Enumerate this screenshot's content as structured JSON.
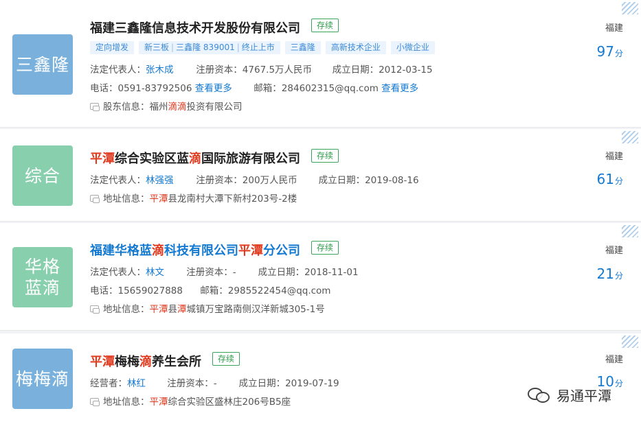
{
  "colors": {
    "logo_blue": "#7ab1dc",
    "logo_green": "#88cfae",
    "highlight_red": "#e0391e",
    "link_blue": "#1479d0",
    "status_green": "#2f9a4c"
  },
  "companies": [
    {
      "logo_lines": [
        "三鑫隆"
      ],
      "name_parts": [
        {
          "t": "福建三鑫隆信息技术开发股份有限公司",
          "hl": false
        }
      ],
      "status": "存续",
      "tags": [
        "定向增发",
        "新三板",
        "三鑫隆",
        "839001",
        "终止上市",
        "三鑫隆",
        "高新技术企业",
        "小微企业"
      ],
      "legal_rep_label": "法定代表人：",
      "legal_rep": "张木成",
      "capital_label": "注册资本：",
      "capital": "4767.5万人民币",
      "founded_label": "成立日期：",
      "founded": "2012-03-15",
      "phone_label": "电话：",
      "phone": "0591-83792506",
      "more_label": "查看更多",
      "email_label": "邮箱：",
      "email": "284602315@qq.com",
      "info_label": "股东信息：",
      "info_parts": [
        "福州",
        "滴滴",
        "投资有限公司"
      ],
      "region": "福建",
      "score": "97",
      "score_unit": "分"
    },
    {
      "logo_lines": [
        "综合"
      ],
      "name_parts": [
        "平潭",
        "综合实验区蓝",
        "滴",
        "国际旅游有限公司"
      ],
      "status": "存续",
      "legal_rep_label": "法定代表人：",
      "legal_rep": "林强强",
      "capital_label": "注册资本：",
      "capital": "200万人民币",
      "founded_label": "成立日期：",
      "founded": "2019-08-16",
      "info_label": "地址信息：",
      "info_parts": [
        "平潭",
        "县龙南村大潭下新村203号-2楼"
      ],
      "region": "福建",
      "score": "61",
      "score_unit": "分"
    },
    {
      "logo_lines": [
        "华格",
        "蓝滴"
      ],
      "name_parts": [
        "福建华格蓝",
        "滴",
        "科技有限公司",
        "平潭",
        "分公司"
      ],
      "status": "存续",
      "legal_rep_label": "法定代表人：",
      "legal_rep": "林文",
      "capital_label": "注册资本：",
      "capital": "-",
      "founded_label": "成立日期：",
      "founded": "2018-11-01",
      "phone_label": "电话：",
      "phone": "15659027888",
      "email_label": "邮箱：",
      "email": "2985522454@qq.com",
      "info_label": "地址信息：",
      "info_parts": [
        "平潭",
        "县",
        "潭",
        "城镇万宝路南侧汉洋新城305-1号"
      ],
      "region": "福建",
      "score": "21",
      "score_unit": "分"
    },
    {
      "logo_lines": [
        "梅梅滴"
      ],
      "name_parts": [
        "平潭",
        "梅梅",
        "滴",
        "养生会所"
      ],
      "status": "存续",
      "legal_rep_label": "经营者：",
      "legal_rep": "林红",
      "capital_label": "注册资本：",
      "capital": "-",
      "founded_label": "成立日期：",
      "founded": "2019-07-19",
      "info_label": "地址信息：",
      "info_parts": [
        "平潭",
        "综合实验区盛林庄206号B5座"
      ],
      "region": "福建",
      "score": "10",
      "score_unit": "分"
    }
  ],
  "watermark": {
    "icon": "wechat-icon",
    "text": "易通平潭"
  }
}
